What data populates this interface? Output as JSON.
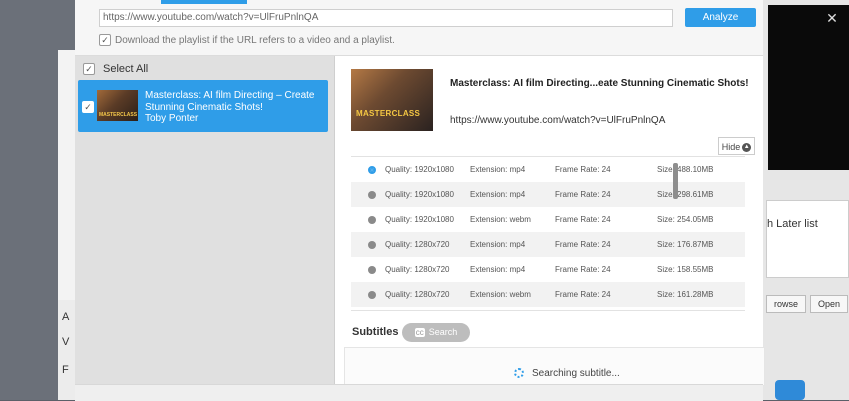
{
  "background": {
    "left_chars": [
      "A",
      "V",
      "F"
    ],
    "watch_later_text": "h Later list",
    "browse_label": "rowse",
    "open_label": "Open",
    "close_glyph": "✕"
  },
  "dialog": {
    "url_value": "https://www.youtube.com/watch?v=UlFruPnlnQA",
    "analyze_label": "Analyze",
    "playlist_checkbox_label": "Download the playlist if the URL refers to a video and a playlist."
  },
  "left_pane": {
    "select_all_label": "Select All",
    "items": [
      {
        "title": "Masterclass: AI film Directing – Create Stunning Cinematic Shots!",
        "author": "Toby Ponter",
        "checked": true,
        "thumb_text": "MASTERCLASS"
      }
    ]
  },
  "detail": {
    "title": "Masterclass: AI film Directing...eate Stunning Cinematic Shots!",
    "url": "https://www.youtube.com/watch?v=UlFruPnlnQA",
    "thumb_text": "MASTERCLASS",
    "hide_label": "Hide"
  },
  "quality_options": [
    {
      "quality": "Quality: 1920x1080",
      "extension": "Extension: mp4",
      "frame_rate": "Frame Rate: 24",
      "size": "Size: 488.10MB",
      "selected": true
    },
    {
      "quality": "Quality: 1920x1080",
      "extension": "Extension: mp4",
      "frame_rate": "Frame Rate: 24",
      "size": "Size: 298.61MB",
      "selected": false
    },
    {
      "quality": "Quality: 1920x1080",
      "extension": "Extension: webm",
      "frame_rate": "Frame Rate: 24",
      "size": "Size: 254.05MB",
      "selected": false
    },
    {
      "quality": "Quality: 1280x720",
      "extension": "Extension: mp4",
      "frame_rate": "Frame Rate: 24",
      "size": "Size: 176.87MB",
      "selected": false
    },
    {
      "quality": "Quality: 1280x720",
      "extension": "Extension: mp4",
      "frame_rate": "Frame Rate: 24",
      "size": "Size: 158.55MB",
      "selected": false
    },
    {
      "quality": "Quality: 1280x720",
      "extension": "Extension: webm",
      "frame_rate": "Frame Rate: 24",
      "size": "Size: 161.28MB",
      "selected": false
    }
  ],
  "subtitles": {
    "label": "Subtitles",
    "search_label": "Search",
    "search_icon": "cc",
    "status": "Searching subtitle..."
  },
  "colors": {
    "accent": "#2f9de8"
  }
}
